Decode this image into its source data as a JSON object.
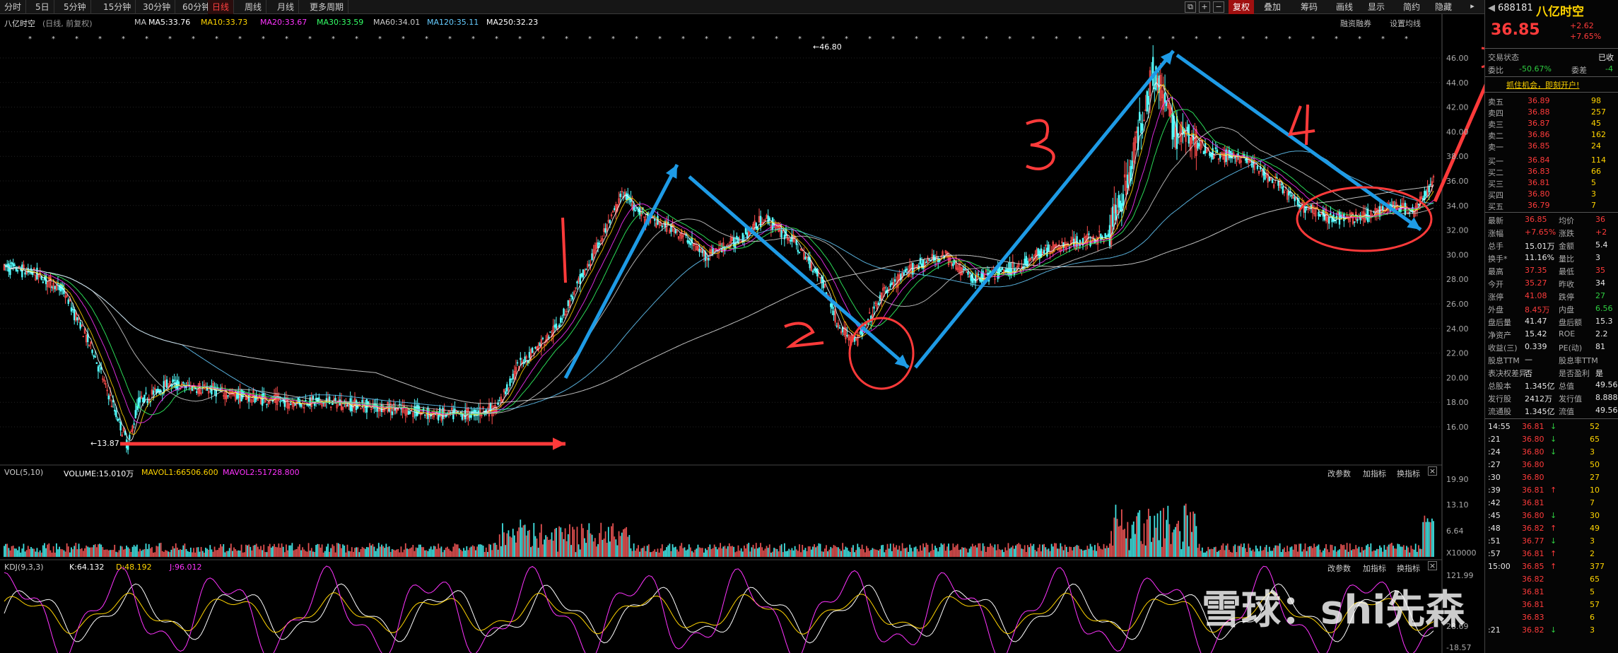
{
  "toolbar": {
    "tabs": [
      "分时",
      "5日",
      "5分钟",
      "15分钟",
      "30分钟",
      "60分钟",
      "日线",
      "周线",
      "月线",
      "更多周期"
    ],
    "active": "日线",
    "right": [
      "复权",
      "叠加",
      "筹码",
      "画线",
      "显示",
      "简约",
      "隐藏"
    ],
    "sub_right": [
      "融资融券",
      "设置均线"
    ]
  },
  "main_panel": {
    "title": "八亿时空",
    "subtitle": "(日线, 前复权)",
    "ma_prefix": "MA",
    "ma": [
      {
        "label": "MA5:33.76",
        "color": "#ffffff"
      },
      {
        "label": "MA10:33.73",
        "color": "#ffd400"
      },
      {
        "label": "MA20:33.67",
        "color": "#ff33ff"
      },
      {
        "label": "MA30:33.59",
        "color": "#33ff66"
      },
      {
        "label": "MA60:34.01",
        "color": "#cccccc"
      },
      {
        "label": "MA120:35.11",
        "color": "#66ccff"
      },
      {
        "label": "MA250:32.23",
        "color": "#ffffff"
      }
    ],
    "high_label": "46.80",
    "low_label": "13.87",
    "y_ticks": [
      "46.00",
      "44.00",
      "42.00",
      "40.00",
      "38.00",
      "36.00",
      "34.00",
      "32.00",
      "30.00",
      "28.00",
      "26.00",
      "24.00",
      "22.00",
      "20.00",
      "18.00",
      "16.00"
    ],
    "annotations": [
      "1",
      "2",
      "3",
      "4"
    ]
  },
  "volume_panel": {
    "indicator": "VOL(5,10)",
    "volume": "VOLUME:15.010万",
    "mavol1": "MAVOL1:66506.600",
    "mavol2": "MAVOL2:51728.800",
    "y_ticks": [
      "19.90",
      "13.10",
      "6.64",
      "X10000"
    ],
    "buttons": [
      "改参数",
      "加指标",
      "换指标"
    ]
  },
  "kdj_panel": {
    "indicator": "KDJ(9,3,3)",
    "k": "K:64.132",
    "d": "D:48.192",
    "j": "J:96.012",
    "y_ticks": [
      "121.99",
      "28.69",
      "-18.57"
    ],
    "buttons": [
      "改参数",
      "加指标",
      "换指标"
    ]
  },
  "right_panel": {
    "code": "688181",
    "name": "八亿时空",
    "price": "36.85",
    "change": "+2.62",
    "change_pct": "+7.65%",
    "trade_status_label": "交易状态",
    "trade_status": "已收",
    "commission_ratio_label": "委比",
    "commission_ratio": "-50.67%",
    "commission_diff_label": "委差",
    "commission_diff": "-4",
    "promo": "抓住机会，即刻开户!",
    "asks": [
      {
        "label": "卖五",
        "price": "36.89",
        "vol": "98"
      },
      {
        "label": "卖四",
        "price": "36.88",
        "vol": "257"
      },
      {
        "label": "卖三",
        "price": "36.87",
        "vol": "45"
      },
      {
        "label": "卖二",
        "price": "36.86",
        "vol": "162"
      },
      {
        "label": "卖一",
        "price": "36.85",
        "vol": "24"
      }
    ],
    "bids": [
      {
        "label": "买一",
        "price": "36.84",
        "vol": "114"
      },
      {
        "label": "买二",
        "price": "36.83",
        "vol": "66"
      },
      {
        "label": "买三",
        "price": "36.81",
        "vol": "5"
      },
      {
        "label": "买四",
        "price": "36.80",
        "vol": "3"
      },
      {
        "label": "买五",
        "price": "36.79",
        "vol": "7"
      }
    ],
    "stats": [
      {
        "l1": "最新",
        "v1": "36.85",
        "c1": "red",
        "l2": "均价",
        "v2": "36",
        "c2": "red"
      },
      {
        "l1": "涨幅",
        "v1": "+7.65%",
        "c1": "red",
        "l2": "涨跌",
        "v2": "+2",
        "c2": "red"
      },
      {
        "l1": "总手",
        "v1": "15.01万",
        "c1": "white",
        "l2": "金额",
        "v2": "5.4",
        "c2": "white"
      },
      {
        "l1": "换手*",
        "v1": "11.16%",
        "c1": "white",
        "l2": "量比",
        "v2": "3",
        "c2": "white"
      },
      {
        "l1": "最高",
        "v1": "37.35",
        "c1": "red",
        "l2": "最低",
        "v2": "35",
        "c2": "red"
      },
      {
        "l1": "今开",
        "v1": "35.27",
        "c1": "red",
        "l2": "昨收",
        "v2": "34",
        "c2": "white"
      },
      {
        "l1": "涨停",
        "v1": "41.08",
        "c1": "red",
        "l2": "跌停",
        "v2": "27",
        "c2": "green"
      },
      {
        "l1": "外盘",
        "v1": "8.45万",
        "c1": "red",
        "l2": "内盘",
        "v2": "6.56",
        "c2": "green"
      },
      {
        "l1": "盘后量",
        "v1": "41.47",
        "c1": "white",
        "l2": "盘后额",
        "v2": "15.3",
        "c2": "white"
      },
      {
        "l1": "净资产",
        "v1": "15.42",
        "c1": "white",
        "l2": "ROE",
        "v2": "2.2",
        "c2": "white"
      },
      {
        "l1": "收益(三)",
        "v1": "0.339",
        "c1": "white",
        "l2": "PE(动)",
        "v2": "81",
        "c2": "white"
      },
      {
        "l1": "股息TTM",
        "v1": "—",
        "c1": "white",
        "l2": "股息率TTM",
        "v2": "",
        "c2": "white"
      },
      {
        "l1": "表决权差异",
        "v1": "否",
        "c1": "white",
        "l2": "是否盈利",
        "v2": "是",
        "c2": "white"
      },
      {
        "l1": "总股本",
        "v1": "1.345亿",
        "c1": "white",
        "l2": "总值",
        "v2": "49.56",
        "c2": "white"
      },
      {
        "l1": "发行股",
        "v1": "2412万",
        "c1": "white",
        "l2": "发行值",
        "v2": "8.888",
        "c2": "white"
      },
      {
        "l1": "流通股",
        "v1": "1.345亿",
        "c1": "white",
        "l2": "流值",
        "v2": "49.56",
        "c2": "white"
      }
    ],
    "ticks": [
      {
        "t": "14:55",
        "p": "36.81",
        "d": "down",
        "v": "52"
      },
      {
        "t": ":21",
        "p": "36.80",
        "d": "down",
        "v": "65"
      },
      {
        "t": ":24",
        "p": "36.80",
        "d": "down",
        "v": "3"
      },
      {
        "t": ":27",
        "p": "36.80",
        "d": "",
        "v": "50"
      },
      {
        "t": ":30",
        "p": "36.80",
        "d": "",
        "v": "27"
      },
      {
        "t": ":39",
        "p": "36.81",
        "d": "up",
        "v": "10"
      },
      {
        "t": ":42",
        "p": "36.81",
        "d": "",
        "v": "7"
      },
      {
        "t": ":45",
        "p": "36.80",
        "d": "down",
        "v": "30"
      },
      {
        "t": ":48",
        "p": "36.82",
        "d": "up",
        "v": "49"
      },
      {
        "t": ":51",
        "p": "36.77",
        "d": "down",
        "v": "3"
      },
      {
        "t": ":57",
        "p": "36.81",
        "d": "up",
        "v": "2"
      },
      {
        "t": "15:00",
        "p": "36.85",
        "d": "up",
        "v": "377"
      },
      {
        "t": "",
        "p": "36.82",
        "d": "",
        "v": "65"
      },
      {
        "t": "",
        "p": "36.81",
        "d": "",
        "v": "5"
      },
      {
        "t": "",
        "p": "36.81",
        "d": "",
        "v": "57"
      },
      {
        "t": "",
        "p": "36.83",
        "d": "",
        "v": "6"
      },
      {
        "t": ":21",
        "p": "36.82",
        "d": "down",
        "v": "3"
      }
    ]
  },
  "watermark": "雪球：shi先森",
  "colors": {
    "up": "#ff3b3b",
    "down": "#2ecc40",
    "arrow_blue": "#1e9be6",
    "arrow_red": "#ff3a3a",
    "kline_up": "#ff4d4d",
    "kline_down": "#54ffff"
  }
}
